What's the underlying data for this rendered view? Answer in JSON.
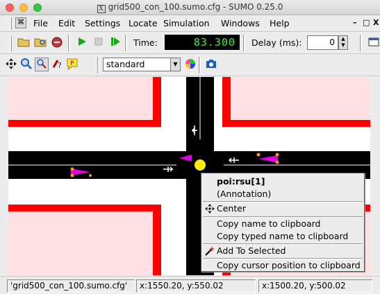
{
  "window": {
    "title": "grid500_con_100.sumo.cfg - SUMO 0.25.0",
    "x_logo": "X"
  },
  "menubar": {
    "items": [
      "File",
      "Edit",
      "Settings",
      "Locate",
      "Simulation",
      "Windows",
      "Help"
    ],
    "underline_first": [
      "F",
      "E",
      "S",
      "L",
      "S",
      "W",
      "H"
    ],
    "controls": [
      "–",
      "□",
      "X"
    ]
  },
  "toolbar": {
    "time_label": "Time:",
    "time_value": "83.300",
    "delay_label": "Delay (ms):",
    "delay_value": "0"
  },
  "view_toolbar": {
    "scheme": "standard"
  },
  "context_menu": {
    "title": "poi:rsu[1]",
    "subtitle": "(Annotation)",
    "center": "Center",
    "copy_name": "Copy name to clipboard",
    "copy_typed_name": "Copy typed name to clipboard",
    "add_to_selected": "Add To Selected",
    "copy_cursor": "Copy cursor position to clipboard"
  },
  "statusbar": {
    "file": "'grid500_con_100.sumo.cfg'",
    "pos1": "x:1550.20, y:550.02",
    "pos2": "x:1500.20, y:500.02"
  },
  "colors": {
    "road": "#000000",
    "curb": "#ff0000",
    "building": "#ffe0e4",
    "vehicle": "#e000e0",
    "poi": "#ffee00"
  }
}
